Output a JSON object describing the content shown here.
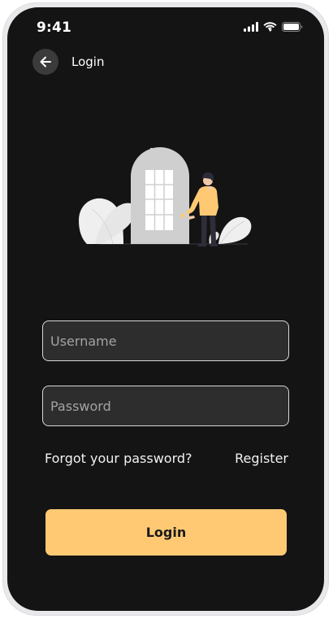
{
  "status_bar": {
    "time": "9:41",
    "icons": [
      "signal-icon",
      "wifi-icon",
      "battery-icon"
    ]
  },
  "header": {
    "back_icon": "arrow-left-icon",
    "title": "Login"
  },
  "illustration": {
    "name": "door-illustration",
    "colors": {
      "door": "#cfcfcf",
      "door_shadow": "#e6e6e6",
      "leaves": "#efefef",
      "shirt": "#ffc974",
      "pants": "#2e2d3a",
      "hair": "#2b2b3a",
      "skin": "#f2c9a8"
    }
  },
  "form": {
    "username_placeholder": "Username",
    "password_placeholder": "Password",
    "username_value": "",
    "password_value": ""
  },
  "links": {
    "forgot_password": "Forgot your password?",
    "register": "Register"
  },
  "actions": {
    "login_label": "Login"
  },
  "colors": {
    "background": "#141414",
    "field_background": "#2d2d2d",
    "field_border": "#d8d8d8",
    "accent": "#ffc974",
    "back_button": "#3b3b3b"
  }
}
